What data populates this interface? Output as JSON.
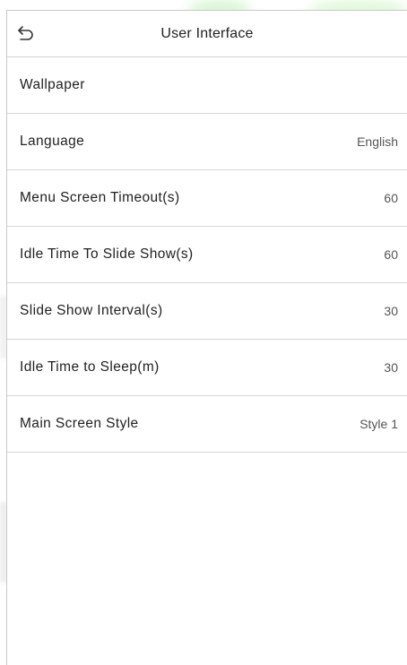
{
  "header": {
    "title": "User Interface",
    "back_icon": "back-arrow-icon"
  },
  "settings": [
    {
      "label": "Wallpaper",
      "value": ""
    },
    {
      "label": "Language",
      "value": "English"
    },
    {
      "label": "Menu Screen Timeout(s)",
      "value": "60"
    },
    {
      "label": "Idle Time To Slide Show(s)",
      "value": "60"
    },
    {
      "label": "Slide Show Interval(s)",
      "value": "30"
    },
    {
      "label": "Idle Time to Sleep(m)",
      "value": "30"
    },
    {
      "label": "Main Screen Style",
      "value": "Style 1"
    }
  ],
  "colors": {
    "background": "#ffffff",
    "divider": "#d6d6d6",
    "text": "#222222",
    "value_text": "#555555"
  }
}
